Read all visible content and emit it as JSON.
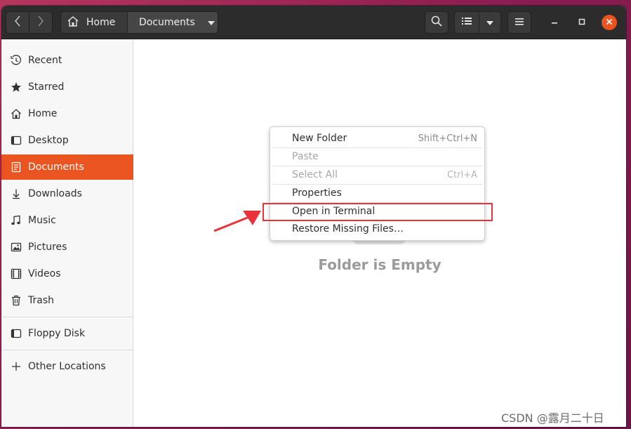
{
  "toolbar": {
    "path": [
      {
        "label": "Home",
        "icon": "home-icon"
      },
      {
        "label": "Documents",
        "icon": "chevron-down-icon"
      }
    ]
  },
  "sidebar": {
    "items": [
      {
        "label": "Recent",
        "icon": "clock-icon",
        "active": false
      },
      {
        "label": "Starred",
        "icon": "star-icon",
        "active": false
      },
      {
        "label": "Home",
        "icon": "home-icon",
        "active": false
      },
      {
        "label": "Desktop",
        "icon": "desktop-icon",
        "active": false
      },
      {
        "label": "Documents",
        "icon": "document-icon",
        "active": true
      },
      {
        "label": "Downloads",
        "icon": "download-icon",
        "active": false
      },
      {
        "label": "Music",
        "icon": "music-icon",
        "active": false
      },
      {
        "label": "Pictures",
        "icon": "picture-icon",
        "active": false
      },
      {
        "label": "Videos",
        "icon": "video-icon",
        "active": false
      },
      {
        "label": "Trash",
        "icon": "trash-icon",
        "active": false
      }
    ],
    "devices": [
      {
        "label": "Floppy Disk",
        "icon": "drive-icon"
      }
    ],
    "other": [
      {
        "label": "Other Locations",
        "icon": "plus-icon"
      }
    ]
  },
  "content": {
    "empty_text": "Folder is Empty"
  },
  "context_menu": {
    "items": [
      {
        "label": "New Folder",
        "accel": "Shift+Ctrl+N",
        "disabled": false
      },
      {
        "label": "Paste",
        "accel": "",
        "disabled": true
      },
      {
        "label": "Select All",
        "accel": "Ctrl+A",
        "disabled": true
      },
      {
        "label": "Properties",
        "accel": "",
        "disabled": false
      },
      {
        "label": "Open in Terminal",
        "accel": "",
        "disabled": false
      },
      {
        "label": "Restore Missing Files…",
        "accel": "",
        "disabled": false
      }
    ]
  },
  "colors": {
    "accent": "#e95420",
    "headerbar": "#2c2c2c",
    "annotation": "#e8333a"
  },
  "watermark": "CSDN @露月二十日"
}
